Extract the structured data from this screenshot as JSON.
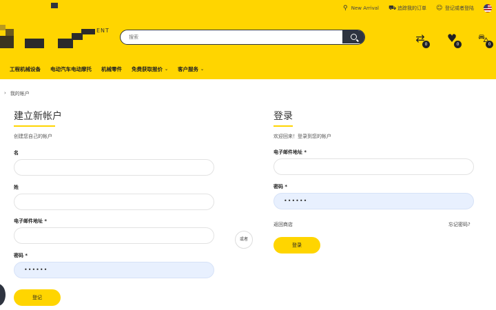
{
  "topbar": {
    "new_arrival": "New Arrival",
    "orders": "追踪我的订单",
    "account": "登记或者登陆"
  },
  "logo": {
    "text": "ENT"
  },
  "search": {
    "placeholder": "搜索"
  },
  "header_icons": [
    {
      "name": "compare-icon",
      "count": "0"
    },
    {
      "name": "wishlist-icon",
      "count": "0"
    },
    {
      "name": "cart-icon",
      "count": "0"
    }
  ],
  "nav": {
    "items": [
      {
        "label": "工程机械设备",
        "dropdown": false
      },
      {
        "label": "电动汽车电动摩托",
        "dropdown": false
      },
      {
        "label": "机械零件",
        "dropdown": false
      },
      {
        "label": "免费获取报价",
        "dropdown": true
      },
      {
        "label": "客户服务",
        "dropdown": true
      }
    ]
  },
  "breadcrumb": {
    "current": "我的帐户"
  },
  "register": {
    "title": "建立新帐户",
    "subtitle": "创建您自己的帐户",
    "first_name_label": "名",
    "last_name_label": "姓",
    "email_label": "电子邮件地址 *",
    "password_label": "密码 *",
    "password_value": "••••••",
    "submit_label": "登记"
  },
  "or_label": "或者",
  "login": {
    "title": "登录",
    "subtitle": "欢迎回来！登录到您的帐户",
    "email_label": "电子邮件地址 *",
    "password_label": "密码 *",
    "password_value": "••••••",
    "back_link": "返回商店",
    "forgot_link": "忘记密码?",
    "submit_label": "登录"
  },
  "colors": {
    "accent": "#FFD500",
    "dark": "#2e3440",
    "autofill": "#e8f0fe"
  }
}
